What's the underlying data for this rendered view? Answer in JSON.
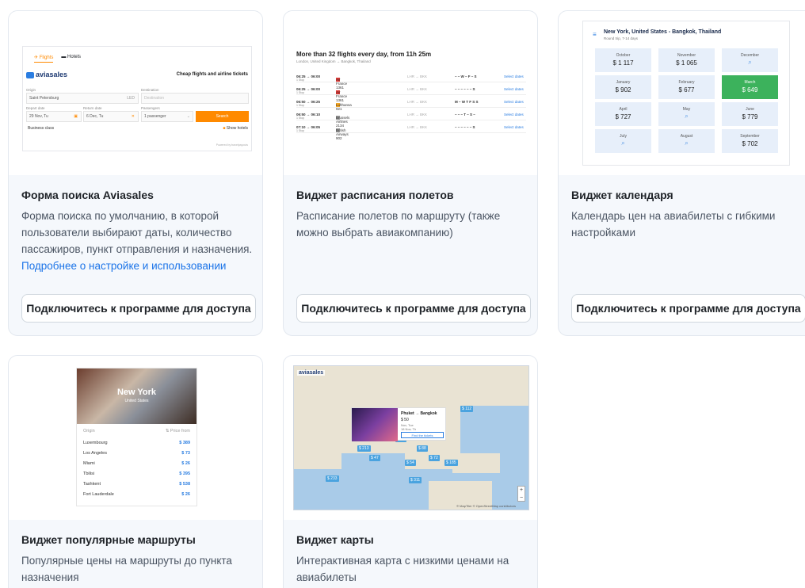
{
  "cards": [
    {
      "title": "Форма поиска Aviasales",
      "description": "Форма поиска по умолчанию, в которой пользователи выбирают даты, количество пассажиров, пункт отправления и назначения.",
      "link": "Подробнее о настройке и использовании",
      "button": "Подключитесь к программе для доступа",
      "preview": {
        "tab_flights": "Flights",
        "tab_hotels": "Hotels",
        "logo": "aviasales",
        "tagline": "Cheap flights and airline tickets",
        "origin_label": "Origin",
        "origin_value": "Saint Petersburg",
        "origin_code": "LED",
        "destination_label": "Destination",
        "destination_placeholder": "Destination",
        "depart_label": "Depart date",
        "depart_value": "29 Nov, Tu",
        "return_label": "Return date",
        "return_value": "6 Dec, Tu",
        "passengers_label": "Passengers",
        "passengers_value": "1 passenger",
        "search_button": "Search",
        "business_class": "Business class",
        "show_hotels": "Show hotels",
        "powered": "Powered by travelpayouts"
      }
    },
    {
      "title": "Виджет расписания полетов",
      "description": "Расписание полетов по маршруту (также можно выбрать авиакомпанию)",
      "button": "Подключитесь к программе для доступа",
      "preview": {
        "heading": "More than 32 flights every day, from 11h 25m",
        "subheading": "London, United Kingdom → Bangkok, Thailand",
        "select_label": "Select dates",
        "rows": [
          {
            "time": "06:25 → 06:00",
            "stops": "1 Stop",
            "airline": "Air France 1361",
            "route": "LHR → BKK",
            "days": "– – W – F – S",
            "color": "#e53935"
          },
          {
            "time": "06:25 → 06:00",
            "stops": "1 Stop",
            "airline": "Air France 1361",
            "route": "LHR → BKK",
            "days": "– – – – – – S",
            "color": "#e53935"
          },
          {
            "time": "06:50 → 06:25",
            "stops": "1 Stop",
            "airline": "Lufthansa 921",
            "route": "LHR → BKK",
            "days": "M – W T F S S",
            "color": "#f5a623"
          },
          {
            "time": "06:50 → 06:10",
            "stops": "1 Stop",
            "airline": "Brussels Airlines 2134",
            "route": "LHR → BKK",
            "days": "– – – T – S –",
            "color": "#9e9e9e"
          },
          {
            "time": "07:10 → 06:05",
            "stops": "1 Stop",
            "airline": "British Airways 902",
            "route": "LHR → BKK",
            "days": "– – – – – – S",
            "color": "#9e9e9e"
          }
        ]
      }
    },
    {
      "title": "Виджет календаря",
      "description": "Календарь цен на авиабилеты с гибкими настройками",
      "button": "Подключитесь к программе для доступа",
      "preview": {
        "heading": "New York, United States - Bangkok, Thailand",
        "subheading": "Round trip, 7-14 days",
        "months": [
          {
            "month": "October",
            "price": "$ 1 117"
          },
          {
            "month": "November",
            "price": "$ 1 065"
          },
          {
            "month": "December",
            "price": ""
          },
          {
            "month": "January",
            "price": "$ 902"
          },
          {
            "month": "February",
            "price": "$ 677"
          },
          {
            "month": "March",
            "price": "$ 649",
            "highlight": true
          },
          {
            "month": "April",
            "price": "$ 727"
          },
          {
            "month": "May",
            "price": ""
          },
          {
            "month": "June",
            "price": "$ 779"
          },
          {
            "month": "July",
            "price": ""
          },
          {
            "month": "August",
            "price": ""
          },
          {
            "month": "September",
            "price": "$ 702"
          }
        ]
      }
    },
    {
      "title": "Виджет популярные маршруты",
      "description": "Популярные цены на маршруты до пункта назначения",
      "preview": {
        "city": "New York",
        "country": "United States",
        "col_origin": "Origin",
        "col_price": "⇅ Price from",
        "rows": [
          {
            "city": "Luxembourg",
            "price": "$ 389"
          },
          {
            "city": "Los Angeles",
            "price": "$ 73"
          },
          {
            "city": "Miami",
            "price": "$ 26"
          },
          {
            "city": "Tbilisi",
            "price": "$ 395"
          },
          {
            "city": "Tashkent",
            "price": "$ 538"
          },
          {
            "city": "Fort Lauderdale",
            "price": "$ 26"
          }
        ]
      }
    },
    {
      "title": "Виджет карты",
      "description": "Интерактивная карта с низкими ценами на авиабилеты",
      "preview": {
        "logo": "aviasales",
        "popup_title": "Phuket → Bangkok",
        "popup_price": "$ 50",
        "popup_line1": "Nov, Tue",
        "popup_line2": "18 Nov, Th",
        "popup_button": "Find the tickets",
        "attribution": "© MapTiler © OpenStreetMap contributors",
        "zoom_in": "+",
        "zoom_out": "−",
        "pins": [
          "$ 213",
          "$ 50",
          "$ 88",
          "$ 72",
          "$ 112",
          "$ 47",
          "$ 54",
          "$ 185",
          "$ 311",
          "$ 233"
        ]
      }
    }
  ]
}
